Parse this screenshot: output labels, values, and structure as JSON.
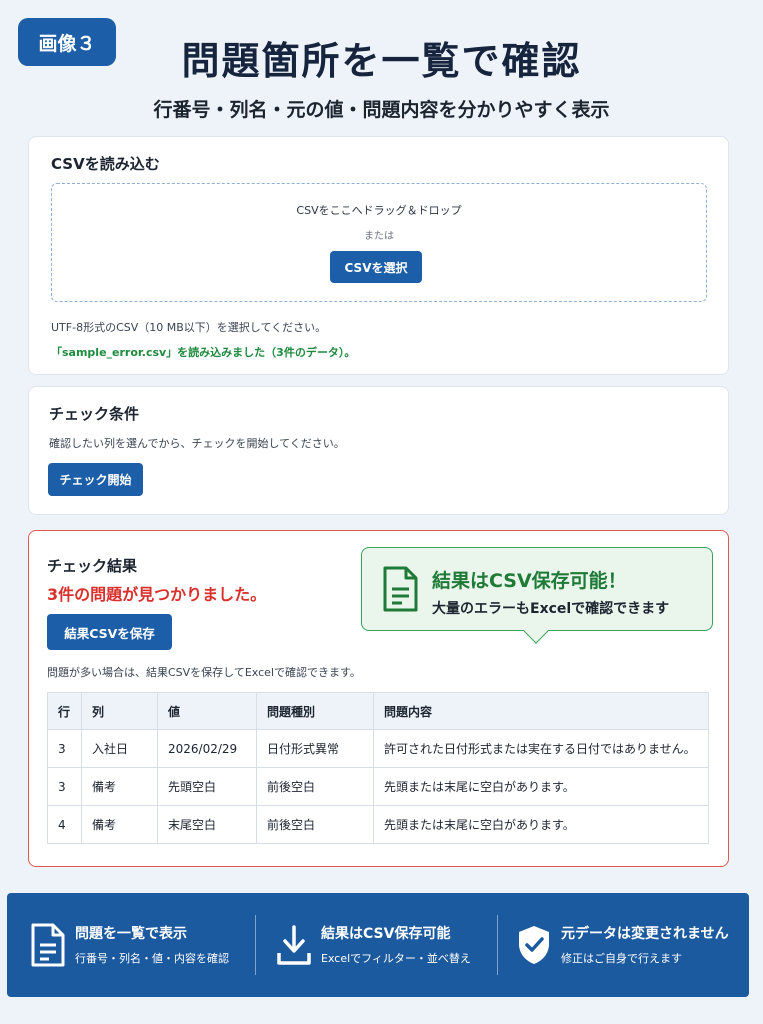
{
  "badge": "画像３",
  "headline": "問題箇所を一覧で確認",
  "subheadline": "行番号・列名・元の値・問題内容を分かりやすく表示",
  "upload": {
    "title": "CSVを読み込む",
    "drop_text": "CSVをここへドラッグ＆ドロップ",
    "or_text": "または",
    "select_button": "CSVを選択",
    "note": "UTF-8形式のCSV（10 MB以下）を選択してください。",
    "status": "「sample_error.csv」を読み込みました（3件のデータ）。"
  },
  "conditions": {
    "title": "チェック条件",
    "description": "確認したい列を選んでから、チェックを開始してください。",
    "start_button": "チェック開始"
  },
  "results": {
    "title": "チェック結果",
    "count_text": "3件の問題が見つかりました。",
    "save_button": "結果CSVを保存",
    "note": "問題が多い場合は、結果CSVを保存してExcelで確認できます。",
    "callout": {
      "title": "結果はCSV保存可能！",
      "subtitle": "大量のエラーもExcelで確認できます"
    },
    "columns": [
      "行",
      "列",
      "値",
      "問題種別",
      "問題内容"
    ],
    "rows": [
      [
        "3",
        "入社日",
        "2026/02/29",
        "日付形式異常",
        "許可された日付形式または実在する日付ではありません。"
      ],
      [
        "3",
        "備考",
        "先頭空白",
        "前後空白",
        "先頭または末尾に空白があります。"
      ],
      [
        "4",
        "備考",
        "末尾空白",
        "前後空白",
        "先頭または末尾に空白があります。"
      ]
    ]
  },
  "footer": {
    "features": [
      {
        "icon": "document-icon",
        "title": "問題を一覧で表示",
        "subtitle": "行番号・列名・値・内容を確認"
      },
      {
        "icon": "download-icon",
        "title": "結果はCSV保存可能",
        "subtitle": "Excelでフィルター・並べ替え"
      },
      {
        "icon": "shield-check-icon",
        "title": "元データは変更されません",
        "subtitle": "修正はご自身で行えます"
      }
    ]
  },
  "colors": {
    "accent": "#1d5ea8",
    "error": "#d9302b",
    "success": "#1e8a3c",
    "callout_border": "#3aa35b",
    "footer_bg": "#1c5aa0"
  }
}
